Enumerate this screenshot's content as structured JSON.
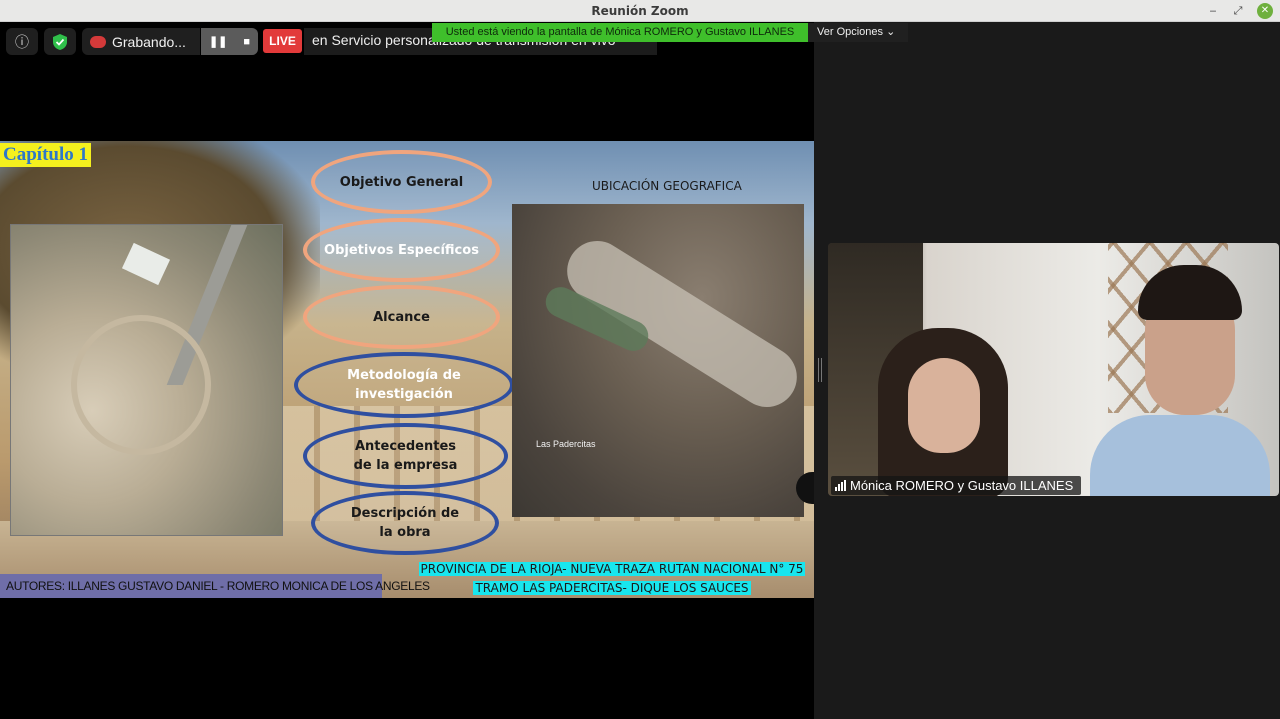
{
  "window": {
    "title": "Reunión Zoom",
    "min": "‒",
    "max": "⤢",
    "close": "✕"
  },
  "toolbar": {
    "info_icon": "ⓘ",
    "shield_icon": "✔",
    "recording_label": "Grabando...",
    "pause_glyph": "❚❚",
    "stop_glyph": "■",
    "live_badge": "LIVE",
    "live_text": "en Servicio personalizado de transmisión en vivo"
  },
  "share_banner": {
    "text": "Usted está viendo la pantalla de Mónica ROMERO y Gustavo ILLANES",
    "options_label": "Ver Opciones ⌄"
  },
  "slide": {
    "chapter": "Capítulo 1",
    "geo_title": "UBICACIÓN GEOGRAFICA",
    "map_place": "Las Padercitas",
    "topics": [
      {
        "label": "Objetivo General",
        "style": "orange-dark"
      },
      {
        "label": "Objetivos Específicos",
        "style": "orange-light"
      },
      {
        "label": "Alcance",
        "style": "orange-dark"
      },
      {
        "label": "Metodología de investigación",
        "style": "blue-light"
      },
      {
        "label": "Antecedentes de la empresa",
        "style": "blue-dark"
      },
      {
        "label": "Descripción de la obra",
        "style": "blue-dark"
      }
    ],
    "authors": "AUTORES: ILLANES GUSTAVO DANIEL - ROMERO MONICA DE LOS ANGELES",
    "province_line1": "PROVINCIA DE LA RIOJA- NUEVA TRAZA RUTAN NACIONAL N° 75",
    "province_line2": "TRAMO LAS PADERCITAS- DIQUE LOS SAUCES"
  },
  "video": {
    "participant_name": "Mónica ROMERO y Gustavo ILLANES"
  },
  "colors": {
    "live": "#e23a3a",
    "banner": "#3fbf2b",
    "chapter_bg": "#f4f01e",
    "province_bg": "#18e6ee",
    "authors_bg": "#6f6ea8"
  }
}
